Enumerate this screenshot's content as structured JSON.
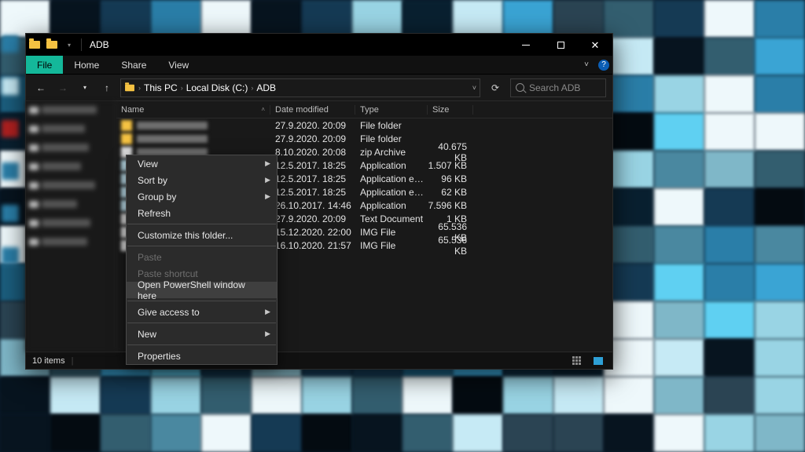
{
  "window": {
    "title": "ADB",
    "ribbon": {
      "file": "File",
      "tabs": [
        "Home",
        "Share",
        "View"
      ]
    },
    "address": {
      "crumbs": [
        "This PC",
        "Local Disk (C:)",
        "ADB"
      ]
    },
    "search": {
      "placeholder": "Search ADB"
    },
    "columns": {
      "name": "Name",
      "date": "Date modified",
      "type": "Type",
      "size": "Size"
    },
    "status": {
      "count_label": "10 items"
    }
  },
  "files": [
    {
      "date": "27.9.2020. 20:09",
      "type": "File folder",
      "size": ""
    },
    {
      "date": "27.9.2020. 20:09",
      "type": "File folder",
      "size": ""
    },
    {
      "date": "8.10.2020. 20:08",
      "type": "zip Archive",
      "size": "40.675 KB"
    },
    {
      "date": "12.5.2017. 18:25",
      "type": "Application",
      "size": "1.507 KB"
    },
    {
      "date": "12.5.2017. 18:25",
      "type": "Application exten...",
      "size": "96 KB"
    },
    {
      "date": "12.5.2017. 18:25",
      "type": "Application exten...",
      "size": "62 KB"
    },
    {
      "date": "26.10.2017. 14:46",
      "type": "Application",
      "size": "7.596 KB"
    },
    {
      "date": "27.9.2020. 20:09",
      "type": "Text Document",
      "size": "1 KB"
    },
    {
      "date": "15.12.2020. 22:00",
      "type": "IMG File",
      "size": "65.536 KB"
    },
    {
      "date": "16.10.2020. 21:57",
      "type": "IMG File",
      "size": "65.536 KB"
    }
  ],
  "context_menu": {
    "items": [
      {
        "label": "View",
        "submenu": true
      },
      {
        "label": "Sort by",
        "submenu": true
      },
      {
        "label": "Group by",
        "submenu": true
      },
      {
        "label": "Refresh"
      },
      {
        "sep": true
      },
      {
        "label": "Customize this folder..."
      },
      {
        "sep": true
      },
      {
        "label": "Paste",
        "disabled": true
      },
      {
        "label": "Paste shortcut",
        "disabled": true
      },
      {
        "label": "Open PowerShell window here",
        "highlight": true
      },
      {
        "sep": true
      },
      {
        "label": "Give access to",
        "submenu": true
      },
      {
        "sep": true
      },
      {
        "label": "New",
        "submenu": true
      },
      {
        "sep": true
      },
      {
        "label": "Properties"
      }
    ]
  }
}
